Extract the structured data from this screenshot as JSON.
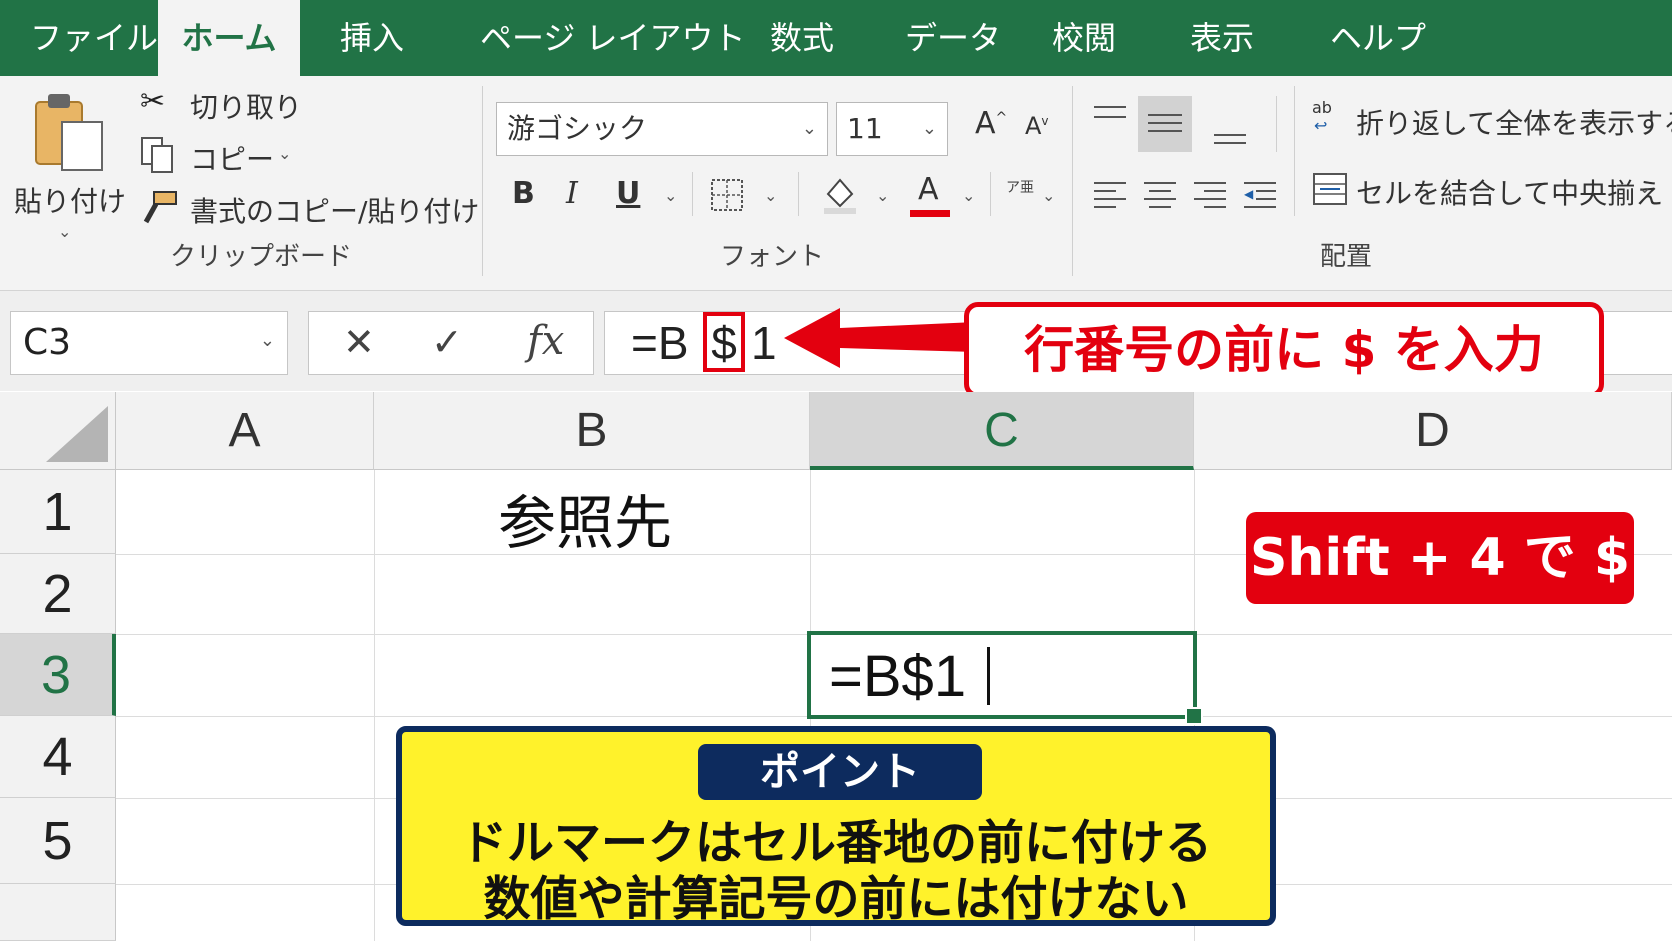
{
  "tabs": [
    {
      "label": "ファイル",
      "active": false
    },
    {
      "label": "ホーム",
      "active": true
    },
    {
      "label": "挿入",
      "active": false
    },
    {
      "label": "ページ レイアウト",
      "active": false
    },
    {
      "label": "数式",
      "active": false
    },
    {
      "label": "データ",
      "active": false
    },
    {
      "label": "校閲",
      "active": false
    },
    {
      "label": "表示",
      "active": false
    },
    {
      "label": "ヘルプ",
      "active": false
    }
  ],
  "clipboard": {
    "paste": "貼り付け",
    "cut": "切り取り",
    "copy": "コピー",
    "format_painter": "書式のコピー/貼り付け",
    "group": "クリップボード"
  },
  "font": {
    "name": "游ゴシック",
    "size": "11",
    "group": "フォント",
    "bold": "B",
    "italic": "I",
    "underline": "U",
    "grow": "A",
    "shrink": "A",
    "color_letter": "A",
    "font_color": "#e3000f",
    "phonetic": "ア亜"
  },
  "alignment": {
    "wrap": "折り返して全体を表示する",
    "merge": "セルを結合して中央揃え",
    "group": "配置",
    "wrap_icon": "ab"
  },
  "formula_bar": {
    "name_box": "C3",
    "cancel": "✕",
    "enter": "✓",
    "fx": "fx",
    "prefix": "=B",
    "dollar": "$",
    "suffix": "1"
  },
  "columns": [
    "A",
    "B",
    "C",
    "D"
  ],
  "rows": [
    "1",
    "2",
    "3",
    "4",
    "5"
  ],
  "cells": {
    "B1": "参照先",
    "C3": "=B$1"
  },
  "callouts": {
    "red_box": "行番号の前に $ を入力",
    "shortcut": "Shift + 4 で $",
    "point_title": "ポイント",
    "point_line1": "ドルマークはセル番地の前に付ける",
    "point_line2": "数値や計算記号の前には付けない"
  },
  "colors": {
    "excel_green": "#217346",
    "accent_red": "#e3000f",
    "callout_yellow": "#fff22b",
    "navy": "#0d2b5e"
  }
}
